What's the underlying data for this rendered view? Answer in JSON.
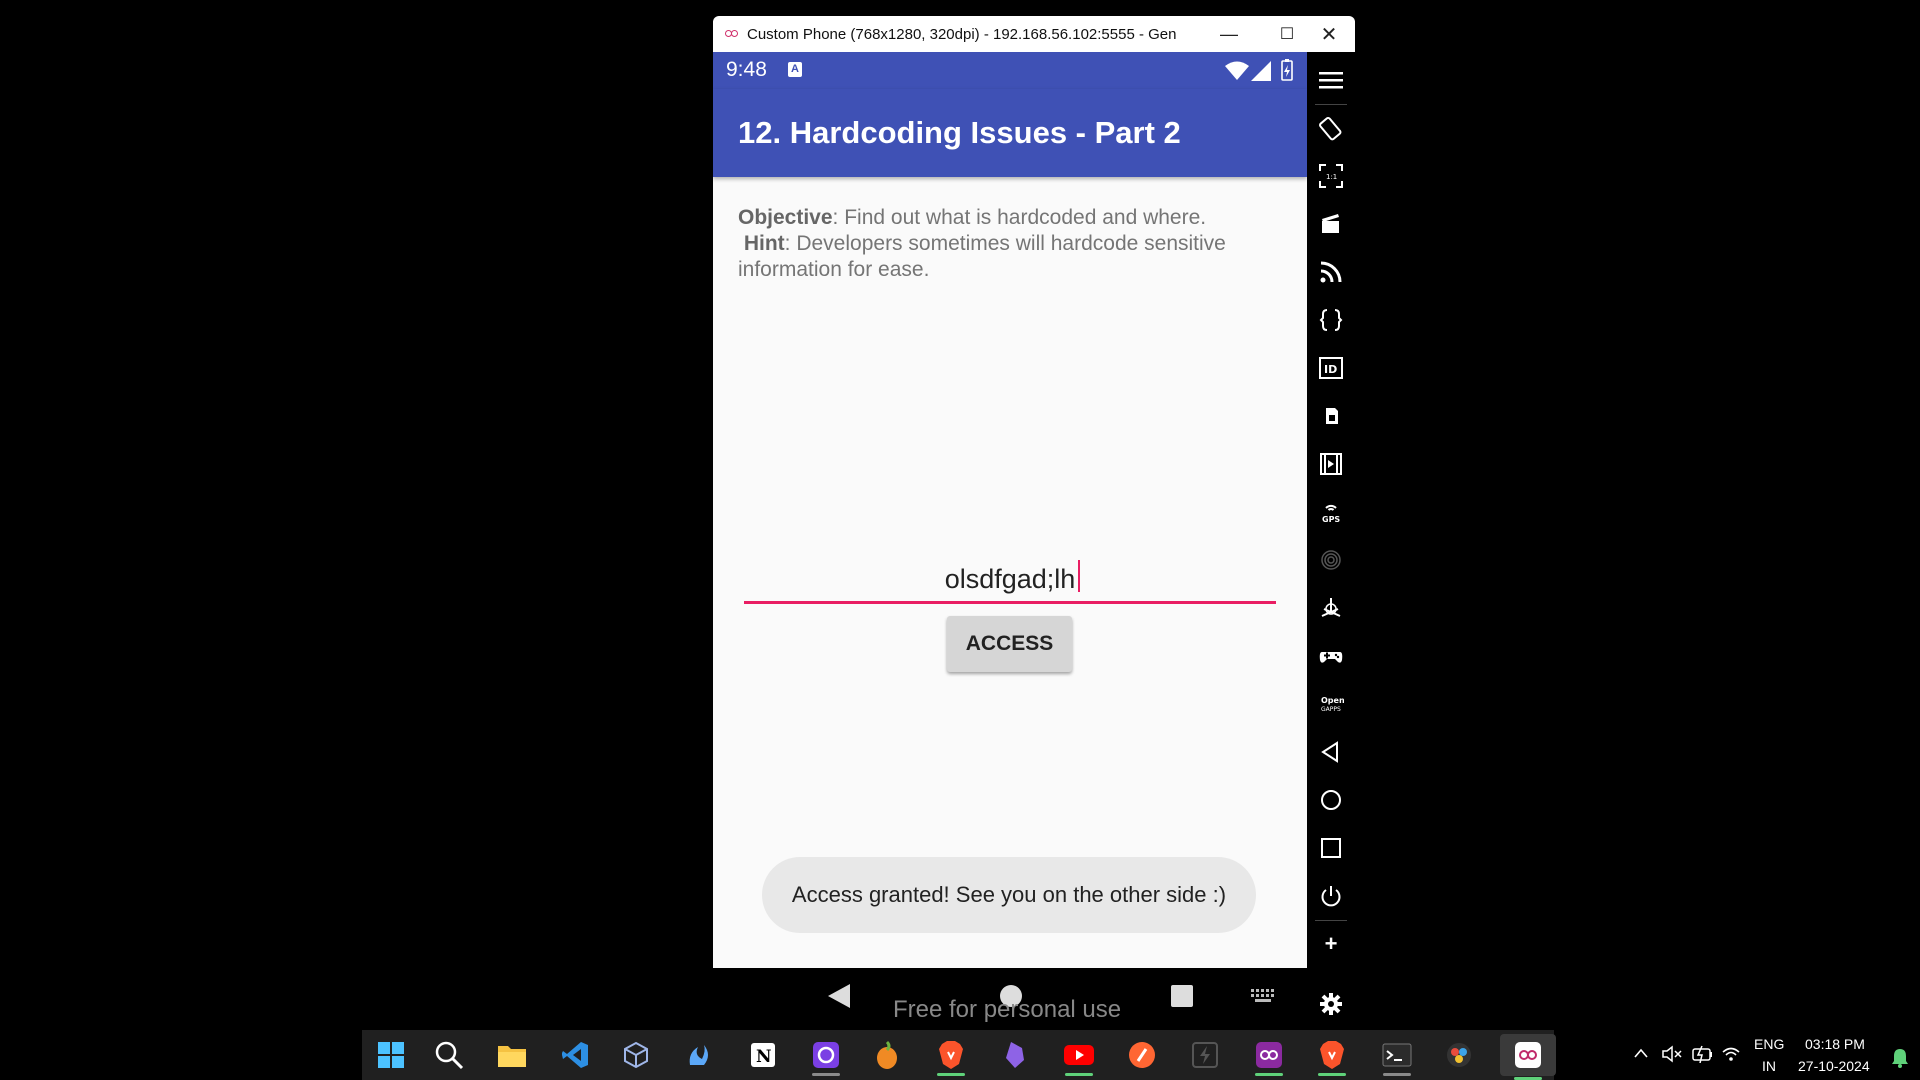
{
  "window": {
    "title": "Custom Phone (768x1280, 320dpi) - 192.168.56.102:5555 - Gen...",
    "minimize_label": "—",
    "maximize_label": "☐",
    "close_label": "✕"
  },
  "phone": {
    "status_time": "9:48",
    "status_a_icon_label": "A",
    "app_title": "12. Hardcoding Issues - Part 2",
    "objective_label": "Objective",
    "objective_text": ": Find out what is hardcoded and where.",
    "hint_label": "Hint",
    "hint_text": ": Developers sometimes will hardcode sensitive information for ease.",
    "password_value": "olsdfgad;lh",
    "access_button": "ACCESS",
    "toast": "Access granted! See you on the other side :)",
    "watermark": "Free for personal use"
  },
  "sidebar": {
    "items": [
      "menu-icon",
      "rotate-icon",
      "pixel-perfect-icon",
      "capture-icon",
      "cast-icon",
      "shell-icon",
      "device-id-icon",
      "sim-icon",
      "media-icon",
      "gps-icon",
      "fingerprint-icon",
      "motion-icon",
      "gamepad-icon",
      "open-gapps-icon",
      "back-icon",
      "home-icon",
      "recents-icon",
      "power-icon",
      "add-icon",
      "settings-icon"
    ],
    "gps_label": "GPS",
    "opengapps_label": "Open GAPPS",
    "add_label": "+"
  },
  "tray": {
    "lang_top": "ENG",
    "lang_bottom": "IN",
    "time": "03:18 PM",
    "date": "27-10-2024"
  },
  "colors": {
    "app_bar": "#3f51b5",
    "accent": "#e91e63",
    "taskbar": "#202020"
  }
}
